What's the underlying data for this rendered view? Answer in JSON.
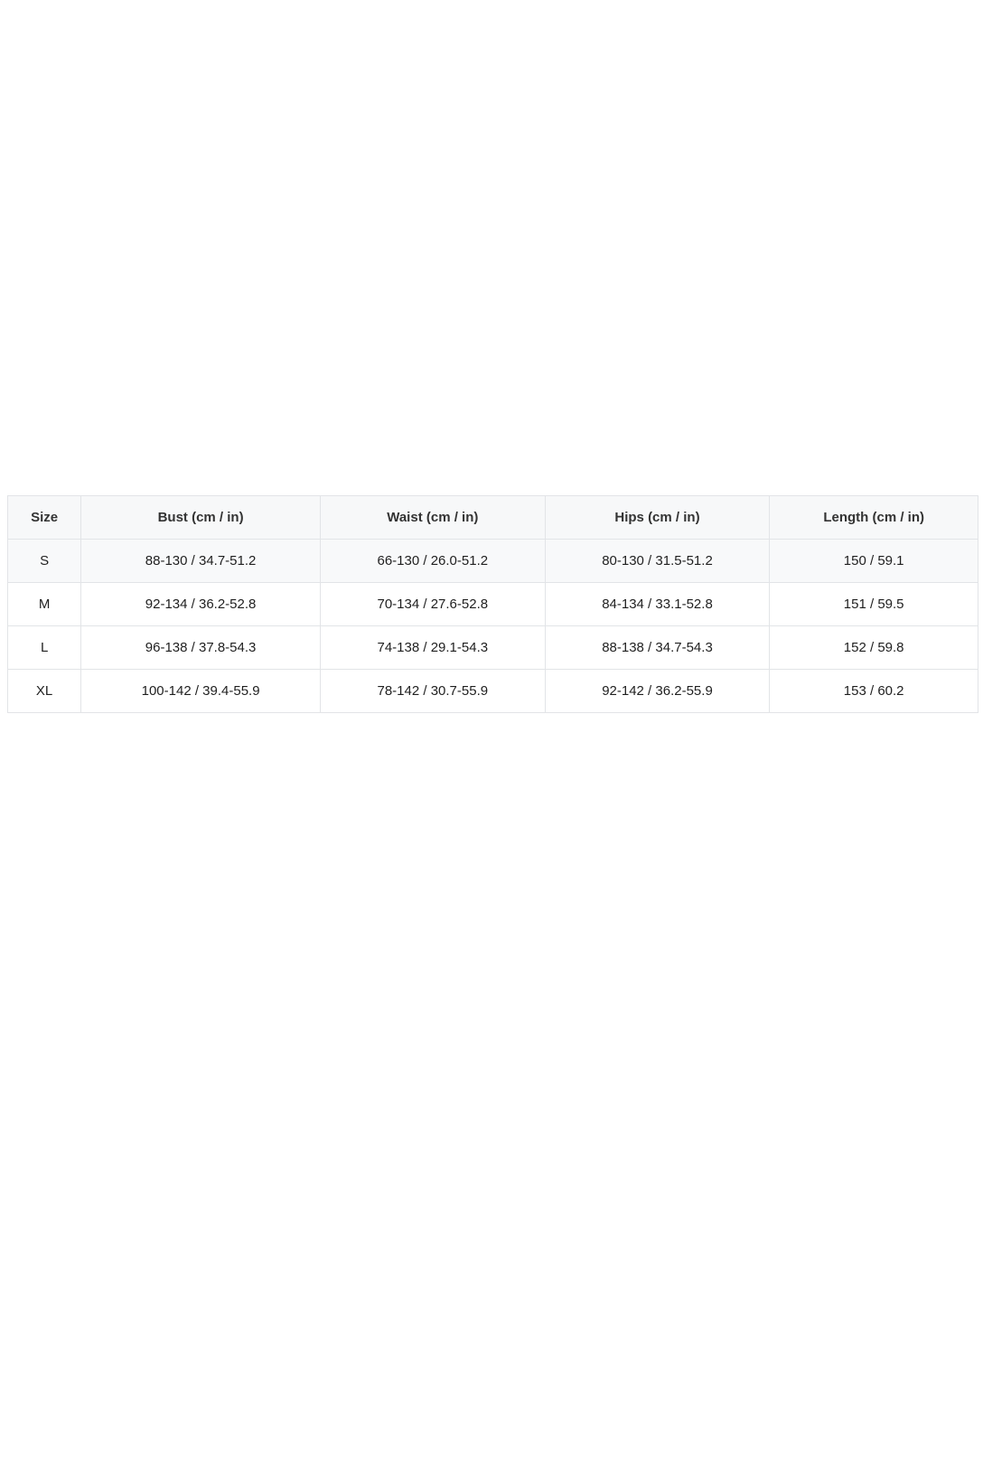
{
  "size_chart": {
    "headers": [
      "Size",
      "Bust (cm / in)",
      "Waist (cm / in)",
      "Hips (cm / in)",
      "Length (cm / in)"
    ],
    "rows": [
      [
        "S",
        "88-130 / 34.7-51.2",
        "66-130 / 26.0-51.2",
        "80-130 / 31.5-51.2",
        "150 / 59.1"
      ],
      [
        "M",
        "92-134 / 36.2-52.8",
        "70-134 / 27.6-52.8",
        "84-134 / 33.1-52.8",
        "151 / 59.5"
      ],
      [
        "L",
        "96-138 / 37.8-54.3",
        "74-138 / 29.1-54.3",
        "88-138 / 34.7-54.3",
        "152 / 59.8"
      ],
      [
        "XL",
        "100-142 / 39.4-55.9",
        "78-142 / 30.7-55.9",
        "92-142 / 36.2-55.9",
        "153 / 60.2"
      ]
    ]
  }
}
